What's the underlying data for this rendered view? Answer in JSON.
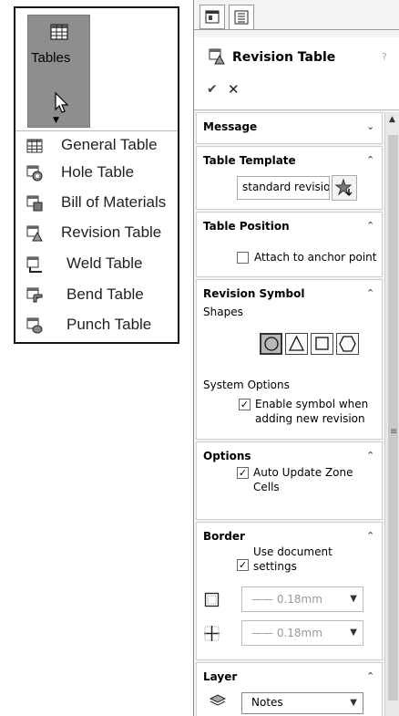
{
  "tables_menu": {
    "button_label": "Tables",
    "items": [
      {
        "label": "General Table",
        "icon": "general-table-icon"
      },
      {
        "label": "Hole Table",
        "icon": "hole-table-icon"
      },
      {
        "label": "Bill of Materials",
        "icon": "bill-of-materials-icon"
      },
      {
        "label": "Revision Table",
        "icon": "revision-table-icon"
      },
      {
        "label": "Weld Table",
        "icon": "weld-table-icon"
      },
      {
        "label": "Bend Table",
        "icon": "bend-table-icon"
      },
      {
        "label": "Punch Table",
        "icon": "punch-table-icon"
      }
    ]
  },
  "property_manager": {
    "title": "Revision Table",
    "help": "?",
    "ok_symbol": "✔",
    "cancel_symbol": "✕",
    "groups": {
      "message": {
        "title": "Message"
      },
      "table_template": {
        "title": "Table Template",
        "value": "standard revisio"
      },
      "table_position": {
        "title": "Table Position",
        "attach_label": "Attach to anchor point",
        "attach_checked": false
      },
      "revision_symbol": {
        "title": "Revision Symbol",
        "shapes_label": "Shapes",
        "shapes": [
          "circle",
          "triangle",
          "square",
          "hexagon"
        ],
        "selected_shape": "circle",
        "system_options_label": "System Options",
        "enable_line1": "Enable symbol when",
        "enable_line2": "adding new revision",
        "enable_checked": true
      },
      "options": {
        "title": "Options",
        "auto_line1": "Auto Update Zone",
        "auto_line2": "Cells",
        "auto_checked": true
      },
      "border": {
        "title": "Border",
        "use_doc_line1": "Use document",
        "use_doc_line2": "settings",
        "use_doc_checked": true,
        "box_border": "0.18mm",
        "grid_border": "0.18mm"
      },
      "layer": {
        "title": "Layer",
        "value": "Notes"
      }
    }
  },
  "colors": {
    "button_gray": "#8e8e8e",
    "panel_bg": "#f4f4f4"
  }
}
